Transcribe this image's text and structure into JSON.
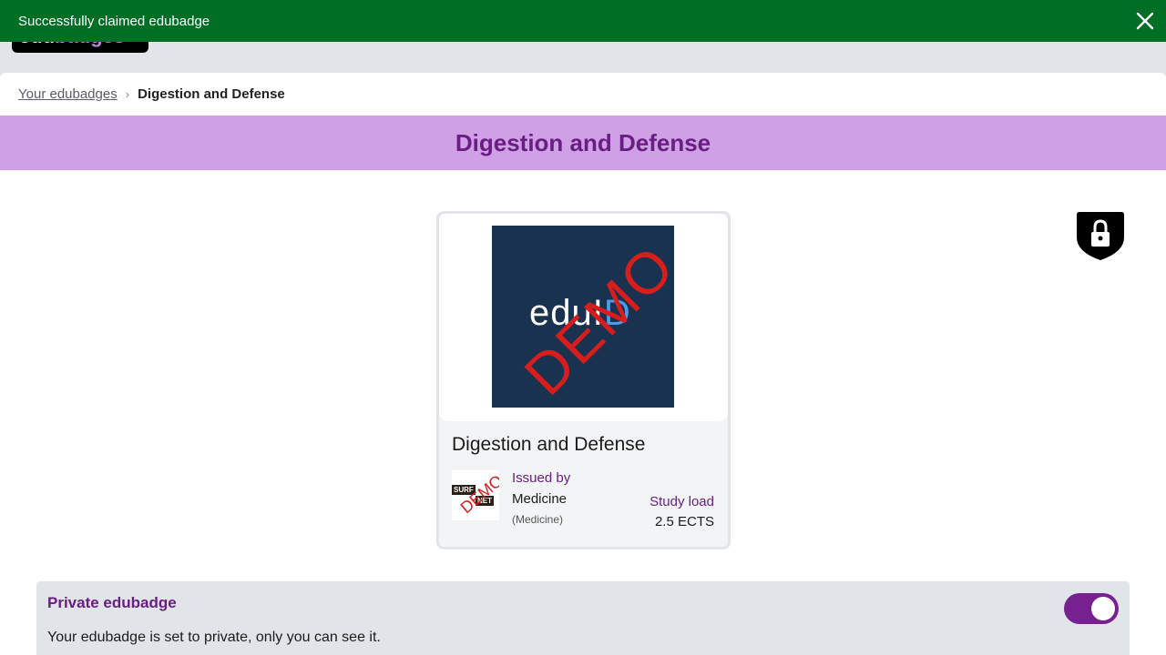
{
  "app": {
    "logo_left": "edu",
    "logo_right": "badges"
  },
  "toast": {
    "message": "Successfully claimed edubadge",
    "close_icon": "close-icon"
  },
  "breadcrumb": {
    "parent": "Your edubadges",
    "separator": "›",
    "current": "Digestion and Defense"
  },
  "page_title": "Digestion and Defense",
  "badge_card": {
    "image_text": "eduID",
    "image_text_accent": "D",
    "image_text_main": "edu",
    "image_text_mid": "I",
    "watermark": "DEMO",
    "title": "Digestion and Defense",
    "issuer_logo_top": "SURF",
    "issuer_logo_bottom": "NET",
    "issuer_logo_watermark": "DEMO",
    "issued_by_label": "Issued by",
    "issuer_name": "Medicine",
    "issuer_sub": "(Medicine)",
    "study_load_label": "Study load",
    "study_load_value": "2.5 ECTS"
  },
  "lock_icon": "lock-shield-icon",
  "private_section": {
    "title": "Private edubadge",
    "description": "Your edubadge is set to private, only you can see it.",
    "toggle_on": true
  },
  "colors": {
    "toast_bg": "#006e25",
    "title_band": "#cfa0e6",
    "accent_purple": "#6a1d83",
    "toggle": "#76218f",
    "badge_bg": "#19324f"
  }
}
